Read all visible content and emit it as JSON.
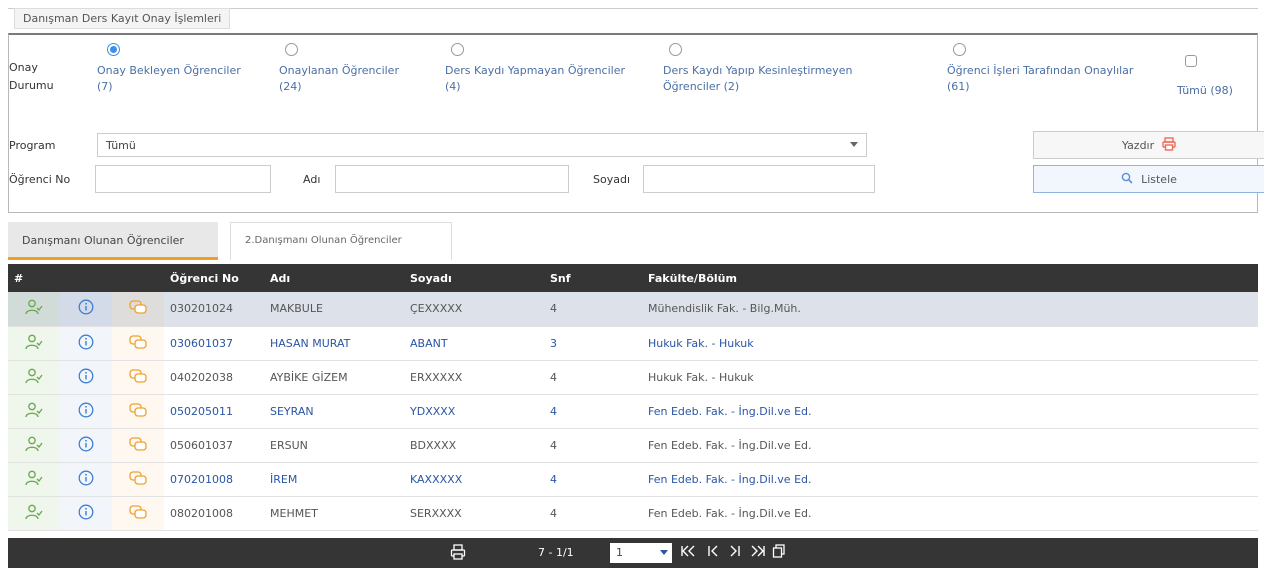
{
  "legend_title": "Danışman Ders Kayıt Onay İşlemleri",
  "onay_durumu_label": "Onay\nDurumu",
  "options": [
    {
      "label": "Onay Bekleyen Öğrenciler",
      "count": "(7)",
      "checked": true
    },
    {
      "label": "Onaylanan Öğrenciler",
      "count": "(24)",
      "checked": false
    },
    {
      "label": "Ders Kaydı Yapmayan Öğrenciler",
      "count": "(4)",
      "checked": false
    },
    {
      "label": "Ders Kaydı Yapıp Kesinleştirmeyen",
      "count": "Öğrenciler (2)",
      "checked": false
    },
    {
      "label": "Öğrenci İşleri Tarafından Onaylılar",
      "count": "(61)",
      "checked": false
    }
  ],
  "tumu_checkbox_label": "Tümü (98)",
  "program_label": "Program",
  "program_value": "Tümü",
  "ogrenci_no_label": "Öğrenci No",
  "adi_label": "Adı",
  "soyadi_label": "Soyadı",
  "yazdir_label": "Yazdır",
  "listele_label": "Listele",
  "tabs": [
    "Danışmanı Olunan Öğrenciler",
    "2.Danışmanı Olunan Öğrenciler"
  ],
  "columns": [
    "#",
    "Öğrenci No",
    "Adı",
    "Soyadı",
    "Snf",
    "Fakülte/Bölüm"
  ],
  "rows": [
    {
      "no": "030201024",
      "adi": "MAKBULE",
      "soyadi": "ÇEXXXXX",
      "snf": "4",
      "fak": "Mühendislik Fak. - Bilg.Müh.",
      "blue": false,
      "selected": true
    },
    {
      "no": "030601037",
      "adi": "HASAN MURAT",
      "soyadi": "ABANT",
      "snf": "3",
      "fak": "Hukuk Fak. - Hukuk",
      "blue": true,
      "selected": false
    },
    {
      "no": "040202038",
      "adi": "AYBİKE GİZEM",
      "soyadi": "ERXXXXX",
      "snf": "4",
      "fak": "Hukuk Fak. - Hukuk",
      "blue": false,
      "selected": false
    },
    {
      "no": "050205011",
      "adi": "SEYRAN",
      "soyadi": "YDXXXX",
      "snf": "4",
      "fak": "Fen Edeb. Fak. - İng.Dil.ve Ed.",
      "blue": true,
      "selected": false
    },
    {
      "no": "050601037",
      "adi": "ERSUN",
      "soyadi": "BDXXXX",
      "snf": "4",
      "fak": "Fen Edeb. Fak. - İng.Dil.ve Ed.",
      "blue": false,
      "selected": false
    },
    {
      "no": "070201008",
      "adi": "İREM",
      "soyadi": "KAXXXXX",
      "snf": "4",
      "fak": "Fen Edeb. Fak. - İng.Dil.ve Ed.",
      "blue": true,
      "selected": false
    },
    {
      "no": "080201008",
      "adi": "MEHMET",
      "soyadi": "SERXXXX",
      "snf": "4",
      "fak": "Fen Edeb. Fak. - İng.Dil.ve Ed.",
      "blue": false,
      "selected": false
    }
  ],
  "pager": {
    "range": "7 - 1/1",
    "page": "1"
  },
  "colors": {
    "header_bg": "#353535",
    "selected_row": "#dde2ea",
    "accent_tab": "#f0a020",
    "link_blue": "#2a55a4",
    "user_icon": "#6aa84f",
    "info_icon": "#3d7fd1",
    "chat_icon": "#f0a030"
  }
}
